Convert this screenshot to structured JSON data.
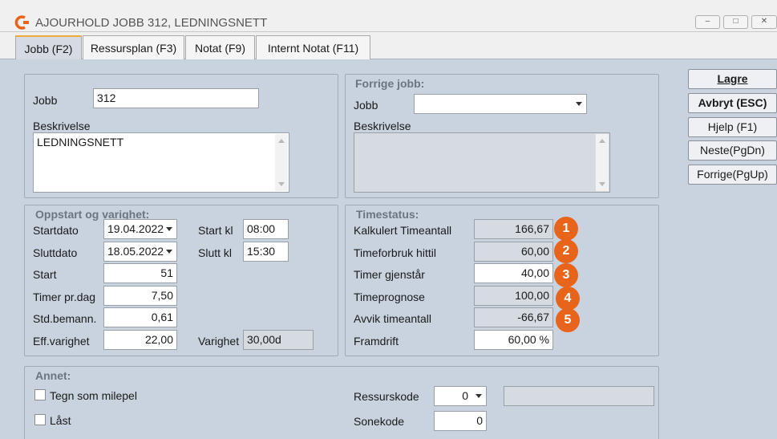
{
  "window": {
    "title": "AJOURHOLD JOBB 312, LEDNINGSNETT",
    "minimize_glyph": "–",
    "maximize_glyph": "□",
    "close_glyph": "✕"
  },
  "tabs": [
    {
      "label": "Jobb (F2)"
    },
    {
      "label": "Ressursplan (F3)"
    },
    {
      "label": "Notat (F9)"
    },
    {
      "label": "Internt Notat (F11)"
    }
  ],
  "job": {
    "job_label": "Jobb",
    "job_value": "312",
    "description_label": "Beskrivelse",
    "description_value": "LEDNINGSNETT"
  },
  "previous_job": {
    "legend": "Forrige jobb:",
    "job_label": "Jobb",
    "job_value": "",
    "description_label": "Beskrivelse",
    "description_value": ""
  },
  "startup": {
    "legend": "Oppstart og varighet:",
    "startdato_label": "Startdato",
    "startdato_value": "19.04.2022",
    "sluttdato_label": "Sluttdato",
    "sluttdato_value": "18.05.2022",
    "start_kl_label": "Start kl",
    "start_kl_value": "08:00",
    "slutt_kl_label": "Slutt kl",
    "slutt_kl_value": "15:30",
    "start_label": "Start",
    "start_value": "51",
    "timer_label": "Timer pr.dag",
    "timer_value": "7,50",
    "std_label": "Std.bemann.",
    "std_value": "0,61",
    "eff_label": "Eff.varighet",
    "eff_value": "22,00",
    "varighet_label": "Varighet",
    "varighet_value": "30,00d"
  },
  "timestatus": {
    "legend": "Timestatus:",
    "rows": [
      {
        "label": "Kalkulert Timeantall",
        "value": "166,67",
        "badge": "1"
      },
      {
        "label": "Timeforbruk hittil",
        "value": "60,00",
        "badge": "2"
      },
      {
        "label": "Timer gjenstår",
        "value": "40,00",
        "badge": "3"
      },
      {
        "label": "Timeprognose",
        "value": "100,00",
        "badge": "4"
      },
      {
        "label": "Avvik timeantall",
        "value": "-66,67",
        "badge": "5"
      },
      {
        "label": "Framdrift",
        "value": "60,00 %"
      }
    ]
  },
  "other": {
    "legend": "Annet:",
    "milepel_label": "Tegn som milepel",
    "laast_label": "Låst",
    "ressurskode_label": "Ressurskode",
    "ressurskode_value": "0",
    "ressurskode_desc": "",
    "sonekode_label": "Sonekode",
    "sonekode_value": "0"
  },
  "side_buttons": {
    "lagre": "Lagre",
    "avbryt": "Avbryt (ESC)",
    "hjelp": "Hjelp (F1)",
    "neste": "Neste(PgDn)",
    "forrige": "Forrige(PgUp)"
  },
  "colors": {
    "accent": "#e8641b",
    "panel_bg": "#c9d3e0",
    "active_tab_border": "#f0a93a"
  }
}
